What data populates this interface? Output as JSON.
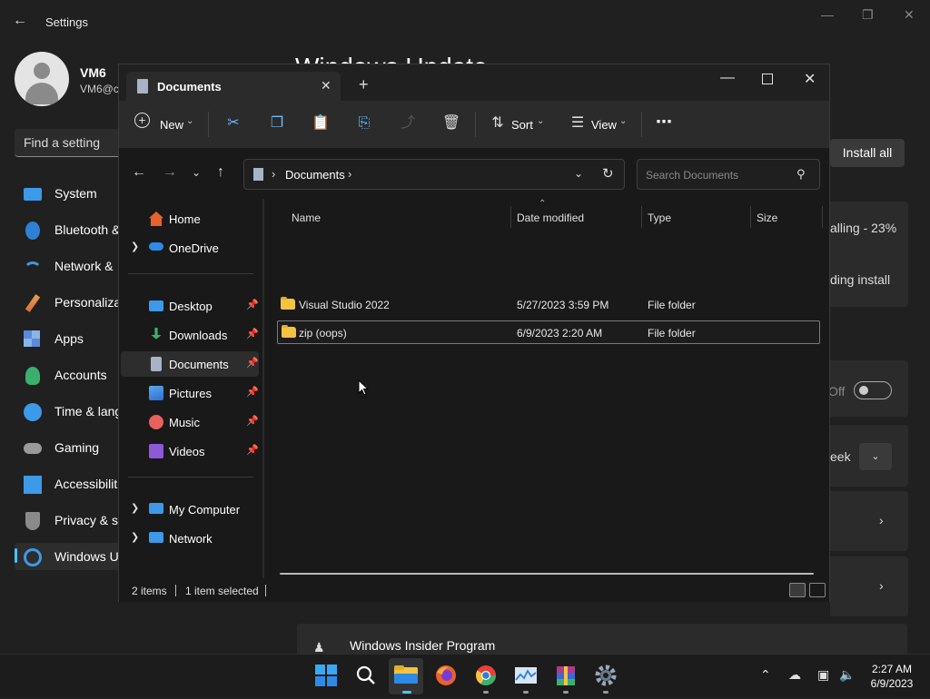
{
  "settings": {
    "title": "Settings",
    "page_title": "Windows Update",
    "user": {
      "name": "VM6",
      "email": "VM6@c"
    },
    "search_placeholder": "Find a setting",
    "nav": [
      {
        "label": "System",
        "icon": "system-icon"
      },
      {
        "label": "Bluetooth &",
        "icon": "bluetooth-icon"
      },
      {
        "label": "Network &",
        "icon": "network-icon"
      },
      {
        "label": "Personaliza",
        "icon": "personalization-icon"
      },
      {
        "label": "Apps",
        "icon": "apps-icon"
      },
      {
        "label": "Accounts",
        "icon": "accounts-icon"
      },
      {
        "label": "Time & lang",
        "icon": "time-icon"
      },
      {
        "label": "Gaming",
        "icon": "gaming-icon"
      },
      {
        "label": "Accessibilit",
        "icon": "accessibility-icon"
      },
      {
        "label": "Privacy & s",
        "icon": "privacy-icon"
      },
      {
        "label": "Windows U",
        "icon": "windows-update-icon"
      }
    ],
    "install_all": "Install all",
    "installing": "alling - 23%",
    "pending": "ding install",
    "toggle_state": "Off",
    "week": "eek",
    "insider": "Windows Insider Program"
  },
  "explorer": {
    "tab_title": "Documents",
    "toolbar": {
      "new": "New",
      "sort": "Sort",
      "view": "View"
    },
    "address": "Documents",
    "search_placeholder": "Search Documents",
    "sidebar": {
      "top": [
        {
          "label": "Home",
          "icon": "home-icon",
          "color": "#e8622c"
        },
        {
          "label": "OneDrive",
          "icon": "onedrive-icon",
          "color": "#2f8ae5"
        }
      ],
      "pinned": [
        {
          "label": "Desktop",
          "icon": "desktop-icon",
          "color": "#3c9ae8"
        },
        {
          "label": "Downloads",
          "icon": "downloads-icon",
          "color": "#3bb06e"
        },
        {
          "label": "Documents",
          "icon": "documents-icon",
          "color": "#a8b4c6"
        },
        {
          "label": "Pictures",
          "icon": "pictures-icon",
          "color": "#3c8fe0"
        },
        {
          "label": "Music",
          "icon": "music-icon",
          "color": "#e8615c"
        },
        {
          "label": "Videos",
          "icon": "videos-icon",
          "color": "#8a5ad8"
        }
      ],
      "bottom": [
        {
          "label": "My Computer",
          "icon": "computer-icon",
          "color": "#3c9ae8"
        },
        {
          "label": "Network",
          "icon": "network-icon",
          "color": "#3c9ae8"
        }
      ]
    },
    "columns": [
      "Name",
      "Date modified",
      "Type",
      "Size"
    ],
    "files": [
      {
        "name": "Visual Studio 2022",
        "date": "5/27/2023 3:59 PM",
        "type": "File folder",
        "size": ""
      },
      {
        "name": "zip (oops)",
        "date": "6/9/2023 2:20 AM",
        "type": "File folder",
        "size": ""
      }
    ],
    "status": {
      "items": "2 items",
      "selected": "1 item selected"
    }
  },
  "taskbar": {
    "time": "2:27 AM",
    "date": "6/9/2023",
    "apps": [
      "start-icon",
      "search-icon",
      "file-explorer-icon",
      "firefox-icon",
      "chrome-icon",
      "task-manager-icon",
      "winrar-icon",
      "settings-icon"
    ]
  }
}
